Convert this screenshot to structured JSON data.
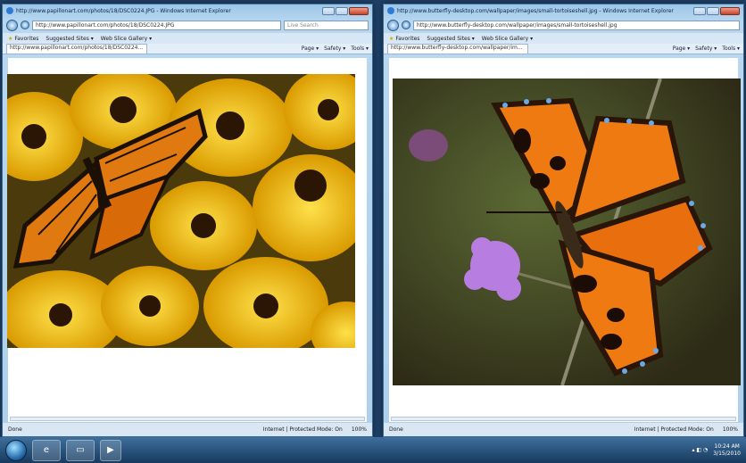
{
  "window1": {
    "title": "http://www.papillonart.com/photos/18/DSC0224.JPG - Windows Internet Explorer",
    "address": "http://www.papillonart.com/photos/18/DSC0224.JPG",
    "search_placeholder": "Live Search",
    "favorites_label": "Favorites",
    "suggested_sites": "Suggested Sites ▾",
    "web_slice": "Web Slice Gallery ▾",
    "tab_label": "http://www.papillonart.com/photos/18/DSC0224...",
    "page_menu": "Page ▾",
    "safety_menu": "Safety ▾",
    "tools_menu": "Tools ▾",
    "status_left": "Done",
    "status_zone": "Internet | Protected Mode: On",
    "zoom": "100%"
  },
  "window2": {
    "title": "http://www.butterfly-desktop.com/wallpaper/images/small-tortoiseshell.jpg - Windows Internet Explorer",
    "address": "http://www.butterfly-desktop.com/wallpaper/images/small-tortoiseshell.jpg",
    "favorites_label": "Favorites",
    "suggested_sites": "Suggested Sites ▾",
    "web_slice": "Web Slice Gallery ▾",
    "tab_label": "http://www.butterfly-desktop.com/wallpaper/im...",
    "page_menu": "Page ▾",
    "safety_menu": "Safety ▾",
    "tools_menu": "Tools ▾",
    "status_left": "Done",
    "status_zone": "Internet | Protected Mode: On",
    "zoom": "100%"
  },
  "taskbar": {
    "clock_time": "10:24 AM",
    "clock_date": "3/15/2010"
  },
  "colors": {
    "accent": "#2e7bd6",
    "taskbar": "#1f4a76",
    "monarch_orange": "#e07a10",
    "tortoiseshell_orange": "#ef7a12",
    "flower_yellow": "#f2c40c"
  },
  "icons": [
    "favicon-icon",
    "back-icon",
    "forward-icon",
    "star-icon",
    "start-orb-icon",
    "ie-icon",
    "folder-icon",
    "media-icon"
  ]
}
